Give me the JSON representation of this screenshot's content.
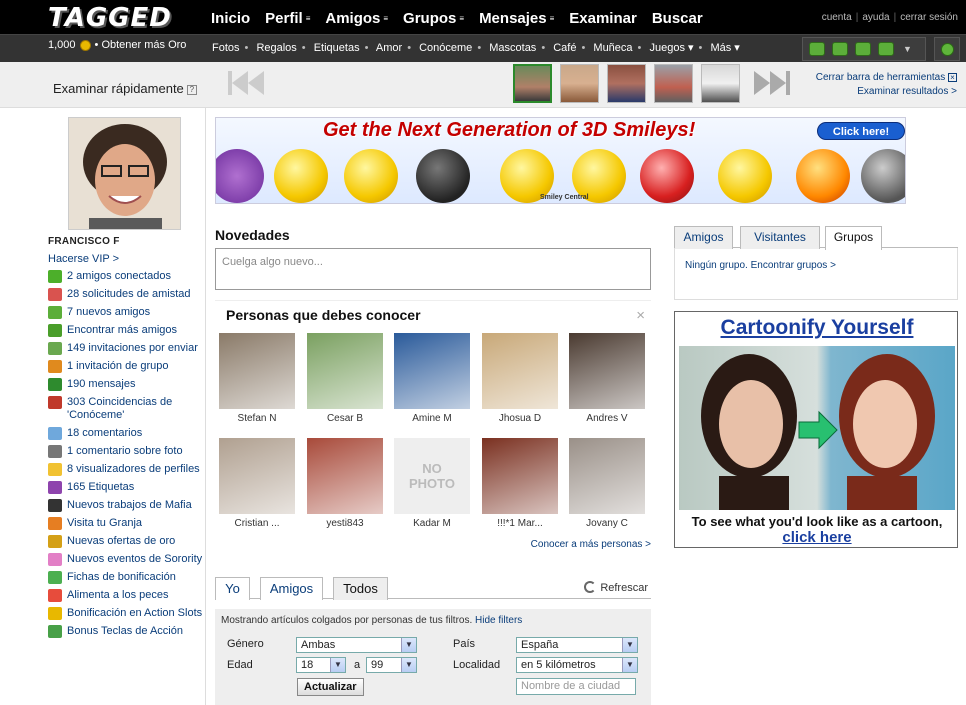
{
  "header": {
    "logo": "TAGGED",
    "nav": [
      {
        "label": "Inicio",
        "dropdown": false
      },
      {
        "label": "Perfil",
        "dropdown": true
      },
      {
        "label": "Amigos",
        "dropdown": true
      },
      {
        "label": "Grupos",
        "dropdown": true
      },
      {
        "label": "Mensajes",
        "dropdown": true
      },
      {
        "label": "Examinar",
        "dropdown": false
      },
      {
        "label": "Buscar",
        "dropdown": false
      }
    ],
    "links": {
      "account": "cuenta",
      "help": "ayuda",
      "logout": "cerrar sesión"
    }
  },
  "subbar": {
    "gold_amount": "1,000",
    "gold_link": "• Obtener más Oro",
    "items": [
      "Fotos",
      "Regalos",
      "Etiquetas",
      "Amor",
      "Conóceme",
      "Mascotas",
      "Café",
      "Muñeca",
      "Juegos ▾",
      "Más ▾"
    ]
  },
  "quick_browse": {
    "title": "Examinar rápidamente",
    "help": "?",
    "close_toolbar": "Cerrar barra de herramientas",
    "browse_results": "Examinar resultados >"
  },
  "user": {
    "name": "FRANCISCO F",
    "vip_link": "Hacerse VIP >"
  },
  "sidebar": [
    {
      "label": "2 amigos conectados",
      "color": "#4caf2a"
    },
    {
      "label": "28 solicitudes de amistad",
      "color": "#d9534f"
    },
    {
      "label": "7 nuevos amigos",
      "color": "#5cae3a"
    },
    {
      "label": "Encontrar más amigos",
      "color": "#4a9e2a"
    },
    {
      "label": "149 invitaciones por enviar",
      "color": "#6aa84f"
    },
    {
      "label": "1 invitación de grupo",
      "color": "#e08a1e"
    },
    {
      "label": "190 mensajes",
      "color": "#2e8b2e"
    },
    {
      "label": "303 Coincidencias de 'Conóceme'",
      "color": "#c0392b"
    },
    {
      "label": "18 comentarios",
      "color": "#6fa8dc"
    },
    {
      "label": "1 comentario sobre foto",
      "color": "#777777"
    },
    {
      "label": "8 visualizadores de perfiles",
      "color": "#f1c232"
    },
    {
      "label": "165 Etiquetas",
      "color": "#8e44ad"
    },
    {
      "label": "Nuevos trabajos de Mafia",
      "color": "#333333"
    },
    {
      "label": "Visita tu Granja",
      "color": "#e67e22"
    },
    {
      "label": "Nuevas ofertas de oro",
      "color": "#d4a017"
    },
    {
      "label": "Nuevos eventos de Sorority",
      "color": "#e27fc6"
    },
    {
      "label": "Fichas de bonificación",
      "color": "#4caf50"
    },
    {
      "label": "Alimenta a los peces",
      "color": "#e74c3c"
    },
    {
      "label": "Bonificación en Action Slots",
      "color": "#e8b800"
    },
    {
      "label": "Bonus Teclas de Acción",
      "color": "#48a048"
    }
  ],
  "banner": {
    "title": "Get the Next Generation of 3D Smileys!",
    "button": "Click here!",
    "brand": "Smiley Central"
  },
  "feed": {
    "title": "Novedades",
    "post_placeholder": "Cuelga algo nuevo..."
  },
  "people": {
    "title": "Personas que debes conocer",
    "close": "×",
    "list": [
      {
        "name": "Stefan N",
        "color": "#8a7a68"
      },
      {
        "name": "Cesar B",
        "color": "#7aa060"
      },
      {
        "name": "Amine M",
        "color": "#2a5a9a"
      },
      {
        "name": "Jhosua D",
        "color": "#c8a878"
      },
      {
        "name": "Andres V",
        "color": "#4a3a30"
      },
      {
        "name": "Cristian ...",
        "color": "#b0a090"
      },
      {
        "name": "yesti843",
        "color": "#a84a3a"
      },
      {
        "name": "Kadar M",
        "color": "#e8e8e8"
      },
      {
        "name": "!!!*1 Mar...",
        "color": "#7a3020"
      },
      {
        "name": "Jovany C",
        "color": "#9a9088"
      }
    ],
    "no_photo": "NO PHOTO",
    "more": "Conocer a más personas >"
  },
  "filters": {
    "tabs": [
      "Yo",
      "Amigos",
      "Todos"
    ],
    "active_tab": "Todos",
    "refresh": "Refrescar",
    "info": "Mostrando artículos colgados por personas de tus filtros.",
    "hide": "Hide filters",
    "gender_label": "Género",
    "gender_value": "Ambas",
    "age_label": "Edad",
    "age_from": "18",
    "age_sep": "a",
    "age_to": "99",
    "country_label": "País",
    "country_value": "España",
    "locality_label": "Localidad",
    "locality_value": "en 5 kilómetros",
    "update_button": "Actualizar",
    "city_placeholder": "Nombre de a ciudad"
  },
  "right": {
    "tabs": [
      "Amigos",
      "Visitantes",
      "Grupos"
    ],
    "active_tab": "Grupos",
    "no_groups": "Ningún grupo. Encontrar grupos >",
    "ad_title": "Cartoonify Yourself",
    "ad_caption": "To see what you'd look like as a cartoon,",
    "ad_link": "click here"
  }
}
